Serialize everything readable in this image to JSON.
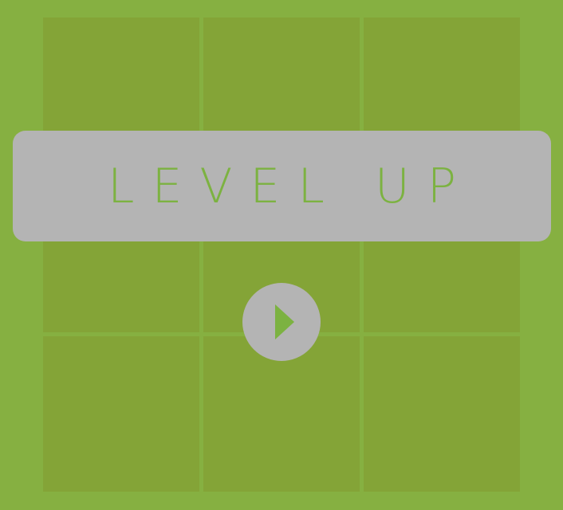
{
  "banner": {
    "text": "LEVEL UP"
  },
  "board": {
    "rows": 3,
    "cols": 3
  },
  "controls": {
    "play_icon": "play-triangle-icon"
  },
  "colors": {
    "background": "#86b041",
    "tile": "#84a437",
    "overlay": "#b4b4b4",
    "accent": "#7cb241"
  }
}
